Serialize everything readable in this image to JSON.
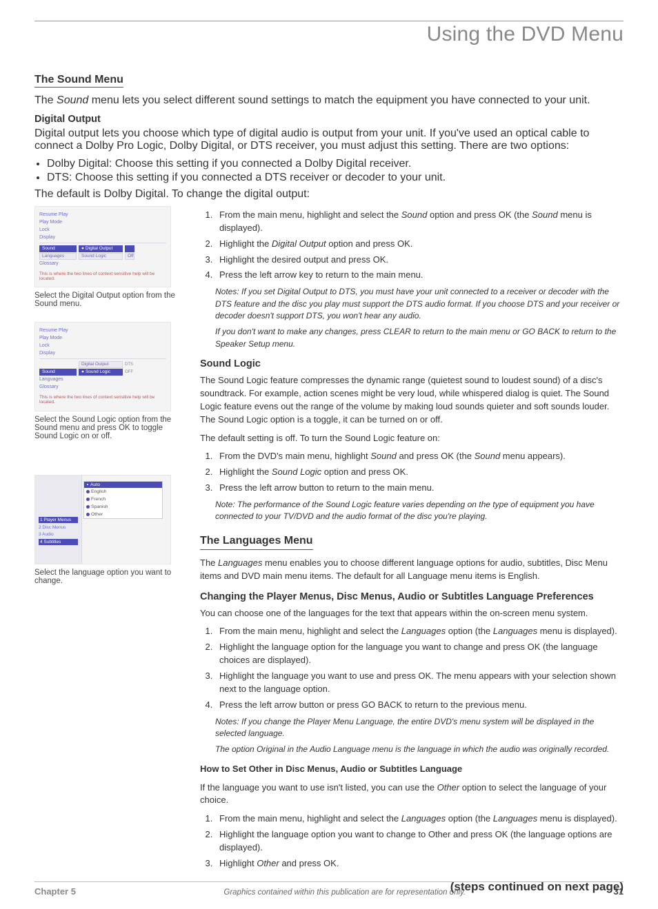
{
  "header": {
    "title": "Using the DVD Menu"
  },
  "left": {
    "shot1": {
      "rows": [
        "Resume Play",
        "Play Mode",
        "Lock",
        "Display"
      ],
      "selected": "Sound",
      "opt1_label": "Digital Output",
      "opt1_val": " ",
      "opt2_label": "Sound Logic",
      "opt2_val": "Off",
      "rows2": [
        "Languages",
        "Glossary"
      ],
      "hint": "This is where the two lines of context sensitive help will be located."
    },
    "caption1": "Select the Digital Output option from the Sound menu.",
    "shot2": {
      "rows": [
        "Resume Play",
        "Play Mode",
        "Lock",
        "Display"
      ],
      "opt1_label": "Digital Output",
      "opt1_val": "DTS",
      "selected": "Sound",
      "opt2_label": "Sound Logic",
      "opt2_val": "OFF",
      "rows2": [
        "Languages",
        "Glossary"
      ],
      "hint": "This is where the two lines of context sensitive help will be located."
    },
    "caption2": "Select the Sound Logic option from the Sound menu and press OK to toggle Sound Logic on or off.",
    "shot3": {
      "side_sel": "1 Player Menus",
      "side_items": [
        "2 Disc Menus",
        "3 Audio",
        "4 Subtitles"
      ],
      "panel_head": "Auto",
      "panel_items": [
        "English",
        "French",
        "Spanish",
        "Other"
      ]
    },
    "caption3": "Select the language option you want to change."
  },
  "sound_menu": {
    "title": "The Sound Menu",
    "intro_a": "The ",
    "intro_i": "Sound",
    "intro_b": " menu lets you select different sound settings to match the equipment you have connected to your unit."
  },
  "digital_output": {
    "title": "Digital Output",
    "p1": "Digital output lets you choose which type of digital audio is output from your unit. If you've used an optical cable to connect a Dolby Pro Logic, Dolby Digital, or DTS receiver, you must adjust this setting. There are two options:",
    "b1": "Dolby Digital: Choose this setting if you connected a Dolby Digital receiver.",
    "b2": "DTS:  Choose this setting if you connected a DTS receiver or decoder to your unit.",
    "p2": "The default is Dolby Digital. To change the digital output:",
    "s1a": "From the main menu, highlight and select the ",
    "s1i": "Sound",
    "s1b": " option and press OK (the ",
    "s1i2": "Sound",
    "s1c": " menu is displayed).",
    "s2a": "Highlight the ",
    "s2i": "Digital Output",
    "s2b": " option and press OK.",
    "s3": "Highlight the desired output and press OK.",
    "s4": "Press the left arrow key to return to the main menu.",
    "n1": "Notes: If you set Digital Output to DTS, you must have your unit connected to a receiver or decoder with the DTS feature and the disc you play must support the DTS audio format. If you choose DTS and your receiver or decoder doesn't support DTS, you won't hear any audio.",
    "n2": "If you don't want to make any changes, press CLEAR to return to the main menu or GO BACK to return to the Speaker Setup menu."
  },
  "sound_logic": {
    "title": "Sound Logic",
    "p1": "The Sound Logic feature compresses the dynamic range (quietest sound to loudest sound) of a disc's soundtrack. For example, action scenes might be very loud, while whispered dialog is quiet. The Sound Logic feature evens out the range of the volume by making loud sounds quieter and soft sounds louder. The Sound Logic option is a toggle, it can be turned on or off.",
    "p2": "The default setting is off. To turn the Sound Logic feature on:",
    "s1a": "From the DVD's main menu, highlight ",
    "s1i": "Sound",
    "s1b": " and press OK (the ",
    "s1i2": "Sound",
    "s1c": " menu appears).",
    "s2a": "Highlight the ",
    "s2i": "Sound Logic",
    "s2b": " option and press OK.",
    "s3": "Press the left arrow button to return to the main menu.",
    "n1": "Note: The performance of the Sound Logic feature varies depending on the type of equipment you have connected to your TV/DVD and the audio format of the disc you're playing."
  },
  "languages": {
    "title": "The Languages Menu",
    "p1a": "The ",
    "p1i": "Languages",
    "p1b": " menu enables you to choose different language options for audio, subtitles, Disc Menu items and DVD main menu items. The default for all Language menu items is English.",
    "sub1": "Changing the Player Menus, Disc Menus, Audio or Subtitles Language Preferences",
    "p2": "You can choose one of the languages for the text that appears within the on-screen menu system.",
    "s1a": "From the main menu, highlight and select the ",
    "s1i": "Languages",
    "s1b": " option (the ",
    "s1i2": "Languages",
    "s1c": " menu is displayed).",
    "s2": "Highlight the language option for the language you want to change and press OK (the language choices are displayed).",
    "s3": "Highlight the language you want to use and press OK. The menu appears with your selection shown next to the language option.",
    "s4": "Press the left arrow button or press GO BACK to return to the previous menu.",
    "n1": "Notes: If you change the Player Menu Language, the entire DVD's menu system will be displayed in the selected language.",
    "n2": "The option Original in the Audio Language menu is the language in which the audio was originally recorded.",
    "sub2": "How to Set Other in Disc Menus, Audio or Subtitles Language",
    "p3a": "If the language you want to use isn't listed, you can use the ",
    "p3i": "Other",
    "p3b": " option to select the language of your choice.",
    "o1a": "From the main menu, highlight and select the ",
    "o1i": "Languages",
    "o1b": " option (the ",
    "o1i2": "Languages",
    "o1c": " menu is displayed).",
    "o2": "Highlight the language option you want to change to Other and press OK (the language options are displayed).",
    "o3a": "Highlight ",
    "o3i": "Other",
    "o3b": " and press OK."
  },
  "continued": "(steps continued on next page)",
  "footer": {
    "chapter": "Chapter 5",
    "mid": "Graphics contained within this publication are for representation only.",
    "page": "31"
  }
}
